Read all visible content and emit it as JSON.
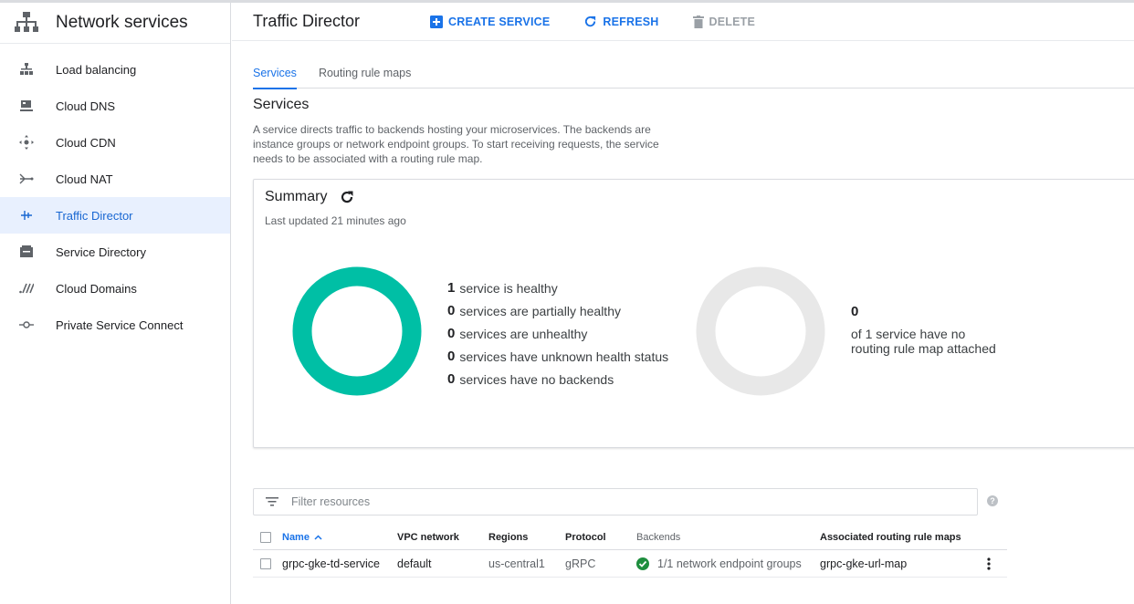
{
  "sidebar": {
    "title": "Network services",
    "items": [
      {
        "label": "Load balancing",
        "icon": "load-balancing-icon",
        "active": false
      },
      {
        "label": "Cloud DNS",
        "icon": "cloud-dns-icon",
        "active": false
      },
      {
        "label": "Cloud CDN",
        "icon": "cloud-cdn-icon",
        "active": false
      },
      {
        "label": "Cloud NAT",
        "icon": "cloud-nat-icon",
        "active": false
      },
      {
        "label": "Traffic Director",
        "icon": "traffic-director-icon",
        "active": true
      },
      {
        "label": "Service Directory",
        "icon": "service-directory-icon",
        "active": false
      },
      {
        "label": "Cloud Domains",
        "icon": "cloud-domains-icon",
        "active": false
      },
      {
        "label": "Private Service Connect",
        "icon": "private-service-connect-icon",
        "active": false
      }
    ]
  },
  "header": {
    "title": "Traffic Director",
    "create_label": "CREATE SERVICE",
    "refresh_label": "REFRESH",
    "delete_label": "DELETE"
  },
  "tabs": [
    {
      "label": "Services",
      "active": true
    },
    {
      "label": "Routing rule maps",
      "active": false
    }
  ],
  "section": {
    "title": "Services",
    "description": "A service directs traffic to backends hosting your microservices. The backends are instance groups or network endpoint groups. To start receiving requests, the service needs to be associated with a routing rule map."
  },
  "summary": {
    "title": "Summary",
    "last_updated": "Last updated 21 minutes ago",
    "health_stats": [
      {
        "count": "1",
        "text": "service is healthy"
      },
      {
        "count": "0",
        "text": "services are partially healthy"
      },
      {
        "count": "0",
        "text": "services are unhealthy"
      },
      {
        "count": "0",
        "text": "services have unknown health status"
      },
      {
        "count": "0",
        "text": "services have no backends"
      }
    ],
    "routing_count": "0",
    "routing_text": "of 1 service have no routing rule map attached",
    "colors": {
      "healthy": "#00bfa5",
      "empty": "#e8e8e8"
    }
  },
  "filter": {
    "placeholder": "Filter resources"
  },
  "table": {
    "headers": {
      "name": "Name",
      "vpc": "VPC network",
      "regions": "Regions",
      "protocol": "Protocol",
      "backends": "Backends",
      "routing": "Associated routing rule maps"
    },
    "rows": [
      {
        "name": "grpc-gke-td-service",
        "vpc": "default",
        "regions": "us-central1",
        "protocol": "gRPC",
        "backends": "1/1 network endpoint groups",
        "routing": "grpc-gke-url-map"
      }
    ]
  },
  "colors": {
    "accent": "#1a73e8",
    "active_bg": "#e8f0fe",
    "healthy": "#1e8e3e"
  }
}
